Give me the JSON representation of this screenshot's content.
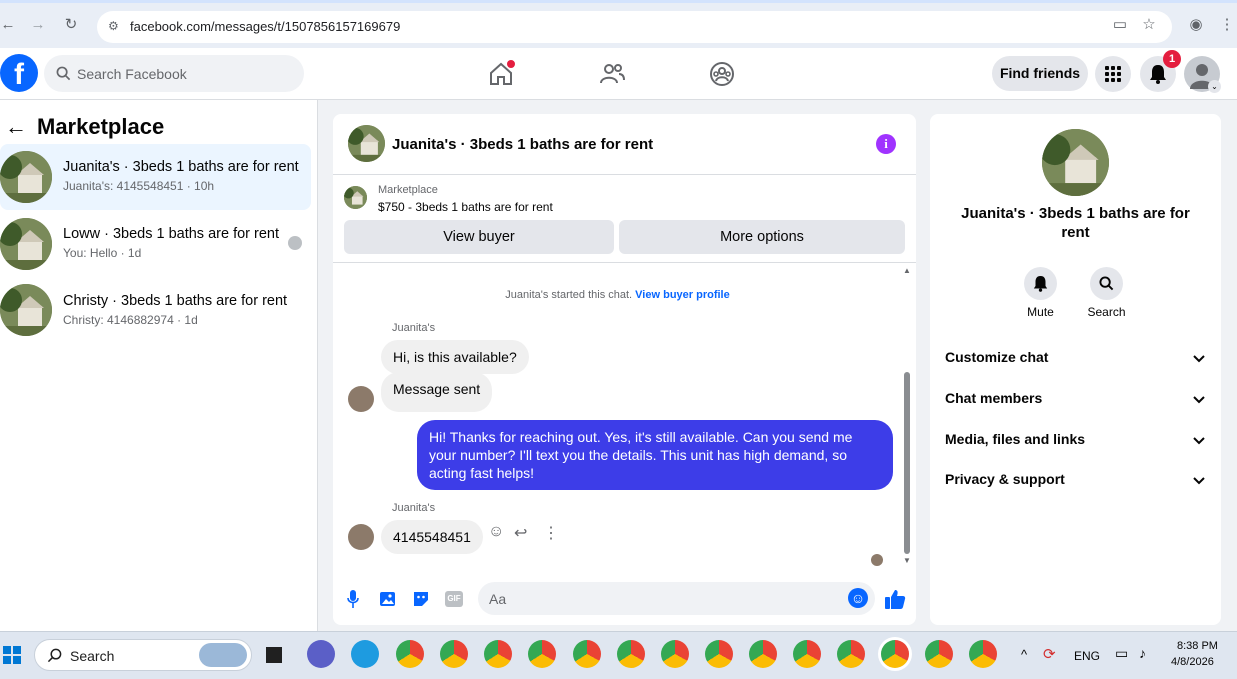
{
  "browser": {
    "url": "facebook.com/messages/t/1507856157169679"
  },
  "header": {
    "search_placeholder": "Search Facebook",
    "find_friends": "Find friends",
    "notification_count": "1"
  },
  "sidebar": {
    "title": "Marketplace",
    "conversations": [
      {
        "name": "Juanita's · 3beds 1 baths are for rent",
        "sub": "Juanita's: 4145548451 · 10h"
      },
      {
        "name": "Loww · 3beds 1 baths are for rent",
        "sub": "You: Hello · 1d"
      },
      {
        "name": "Christy · 3beds 1 baths are for rent",
        "sub": "Christy: 4146882974 · 1d"
      }
    ]
  },
  "chat": {
    "title": "Juanita's · 3beds 1 baths are for rent",
    "listing_source": "Marketplace",
    "listing_detail": "$750 - 3beds 1 baths are for rent",
    "view_buyer": "View buyer",
    "more_options": "More options",
    "started_text": "Juanita's started this chat.",
    "view_buyer_profile": "View buyer profile",
    "sender_name": "Juanita's",
    "messages": [
      {
        "text": "Hi, is this available?"
      },
      {
        "text": "Message sent"
      },
      {
        "text": "Hi! Thanks for reaching out. Yes, it's still available. Can you send me your number? I'll text you the details. This unit has high demand, so acting fast helps!"
      },
      {
        "text": "4145548451"
      }
    ],
    "composer_placeholder": "Aa"
  },
  "details": {
    "title": "Juanita's · 3beds 1 baths are for rent",
    "mute": "Mute",
    "search": "Search",
    "sections": [
      "Customize chat",
      "Chat members",
      "Media, files and links",
      "Privacy & support"
    ]
  },
  "taskbar": {
    "search": "Search",
    "lang": "ENG",
    "time": "8:38 PM",
    "date": "4/8/2026"
  },
  "colors": {
    "accent": "#0866ff",
    "sent_bubble": "#3d3de8",
    "info": "#a033ff"
  }
}
